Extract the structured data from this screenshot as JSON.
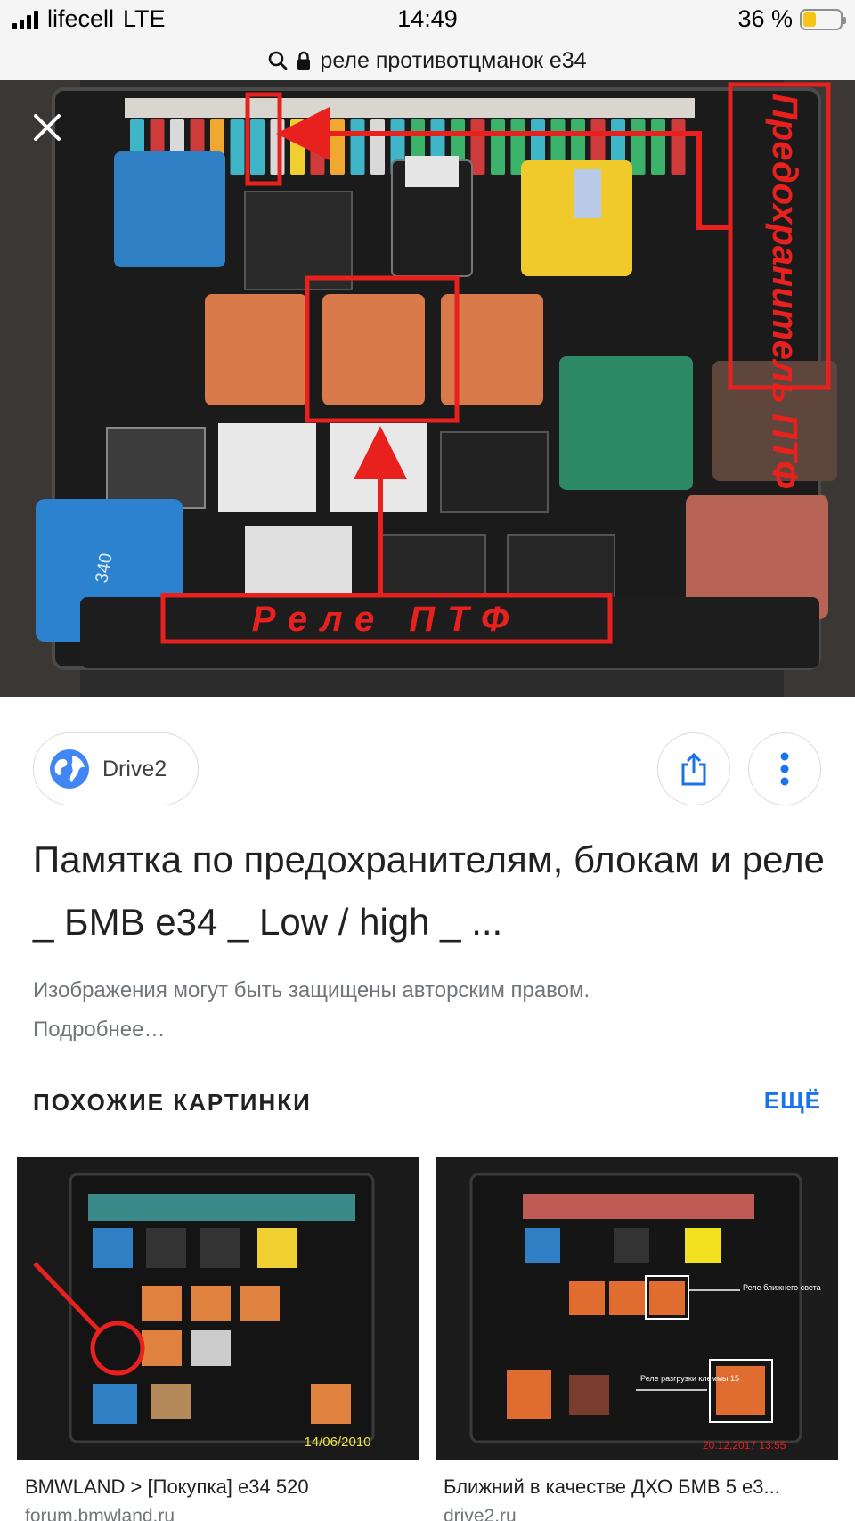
{
  "status_bar": {
    "carrier": "lifecell",
    "network": "LTE",
    "time": "14:49",
    "battery": "36 %",
    "battery_level": 0.36
  },
  "url_bar": {
    "query": "реле противотцманок е34"
  },
  "hero_image": {
    "annotations": {
      "fuse_label": "Предохранитель ПТФ",
      "relay_label": "Реле ПТФ"
    },
    "relay_printed_text": "340"
  },
  "source": {
    "name": "Drive2"
  },
  "result": {
    "title": "Памятка по предохранителям, блокам и реле _ БМВ е34 _ Low / high _ ...",
    "copyright_note": "Изображения могут быть защищены авторским правом. Подробнее…"
  },
  "similar": {
    "heading": "ПОХОЖИЕ КАРТИНКИ",
    "more_label": "ЕЩЁ",
    "items": [
      {
        "caption": "BMWLAND > [Покупка] е34 520",
        "domain": "forum.bmwland.ru",
        "stamp": "14/06/2010"
      },
      {
        "caption": "Ближний в качестве ДХО БМВ 5 е3...",
        "domain": "drive2.ru",
        "label_a": "Реле ближнего света",
        "label_b": "Реле разгрузки клеммы 15"
      }
    ]
  },
  "colors": {
    "accent_blue": "#1a73e8",
    "annotation_red": "#e8201e",
    "relay_orange": "#d87a4a"
  }
}
